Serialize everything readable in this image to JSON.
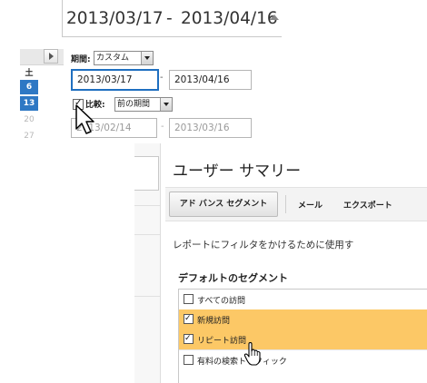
{
  "date_range": {
    "start": "2013/03/17",
    "separator": "-",
    "end": "2013/04/16"
  },
  "calendar": {
    "day_of_week": "土",
    "days": [
      "6",
      "13",
      "20",
      "27"
    ]
  },
  "period": {
    "label": "期間:",
    "selected": "カスタム",
    "start": "2013/03/17",
    "end": "2013/04/16",
    "dash": "-"
  },
  "compare": {
    "checked": true,
    "label": "比較:",
    "selected": "前の期間",
    "start": "2013/02/14",
    "end": "2013/03/16",
    "dash": "-"
  },
  "summary": {
    "title": "ユーザー サマリー",
    "toolbar": {
      "advanced_segments": "アド バンス セグメント",
      "mail": "メール",
      "export": "エクスポート"
    },
    "description": "レポートにフィルタをかけるために使用す",
    "segments_heading": "デフォルトのセグメント",
    "segments": [
      {
        "label": "すべての訪問",
        "checked": false
      },
      {
        "label": "新規訪問",
        "checked": true
      },
      {
        "label": "リピート訪問",
        "checked": true
      },
      {
        "label": "有料の検索トラフィック",
        "checked": false
      }
    ]
  },
  "colors": {
    "accent": "#2e78c4",
    "highlight": "#fcc866"
  }
}
